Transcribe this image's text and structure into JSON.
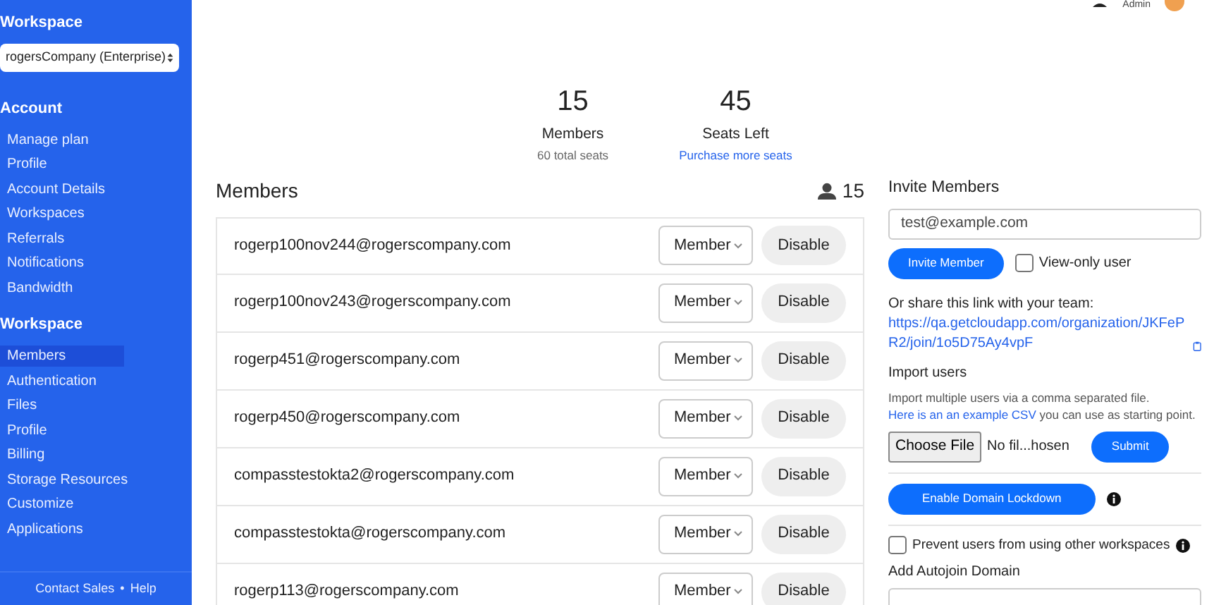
{
  "sidebar": {
    "workspace_label": "Workspace",
    "workspace_select": "rogersCompany (Enterprise)",
    "sections": [
      {
        "heading": "Account",
        "items": [
          {
            "label": "Manage plan",
            "selected": false
          },
          {
            "label": "Profile",
            "selected": false
          },
          {
            "label": "Account Details",
            "selected": false
          },
          {
            "label": "Workspaces",
            "selected": false
          },
          {
            "label": "Referrals",
            "selected": false
          },
          {
            "label": "Notifications",
            "selected": false
          },
          {
            "label": "Bandwidth",
            "selected": false
          }
        ]
      },
      {
        "heading": "Workspace",
        "items": [
          {
            "label": "Members",
            "selected": true
          },
          {
            "label": "Authentication",
            "selected": false
          },
          {
            "label": "Files",
            "selected": false
          },
          {
            "label": "Profile",
            "selected": false
          },
          {
            "label": "Billing",
            "selected": false
          },
          {
            "label": "Storage Resources",
            "selected": false
          },
          {
            "label": "Customize",
            "selected": false
          },
          {
            "label": "Applications",
            "selected": false
          }
        ]
      }
    ],
    "footer": {
      "links": [
        "Contact Sales",
        "Help"
      ],
      "separator": "•"
    }
  },
  "header": {
    "user": "Admin"
  },
  "stats": [
    {
      "value": "15",
      "label": "Members",
      "note": "60 total seats"
    },
    {
      "value": "45",
      "label": "Seats Left",
      "link": "Purchase more seats"
    }
  ],
  "members": {
    "title": "Members",
    "count": "15",
    "rows": [
      {
        "email": "rogerp100nov244@rogerscompany.com",
        "role": "Member",
        "action": "Disable"
      },
      {
        "email": "rogerp100nov243@rogerscompany.com",
        "role": "Member",
        "action": "Disable"
      },
      {
        "email": "rogerp451@rogerscompany.com",
        "role": "Member",
        "action": "Disable"
      },
      {
        "email": "rogerp450@rogerscompany.com",
        "role": "Member",
        "action": "Disable"
      },
      {
        "email": "compasstestokta2@rogerscompany.com",
        "role": "Member",
        "action": "Disable"
      },
      {
        "email": "compasstestokta@rogerscompany.com",
        "role": "Member",
        "action": "Disable"
      },
      {
        "email": "rogerp113@rogerscompany.com",
        "role": "Member",
        "action": "Disable"
      }
    ]
  },
  "invite": {
    "title": "Invite Members",
    "email_value": "test@example.com",
    "button": "Invite Member",
    "view_only": {
      "label": "View-only user",
      "checked": false
    },
    "share_text": "Or share this link with your team:",
    "share_link": "https://qa.getcloudapp.com/organization/JKFePR2/join/1o5D75Ay4vpF",
    "import_title": "Import users",
    "import_text": "Import multiple users via a comma separated file.",
    "import_link": "Here is an an example CSV",
    "import_text_end": "you can use as starting point.",
    "choose_file": "Choose File",
    "file_name": "No fil...hosen",
    "submit": "Submit",
    "lockdown_button": "Enable Domain Lockdown",
    "prevent": {
      "label": "Prevent users from using other workspaces",
      "checked": false
    },
    "autojoin_title": "Add Autojoin Domain"
  }
}
